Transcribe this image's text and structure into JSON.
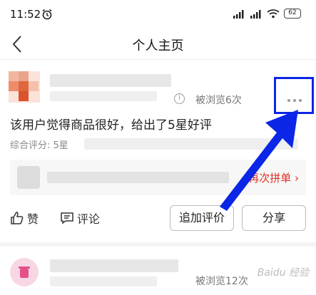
{
  "status_bar": {
    "time": "11:52",
    "battery": "62",
    "signal_1": "5G",
    "signal_2": "5G"
  },
  "nav": {
    "title": "个人主页"
  },
  "review": {
    "views": "被浏览6次",
    "text": "该用户觉得商品很好，给出了5星好评",
    "score_label": "综合评分: 5星",
    "rebuy_label": "再次拼单",
    "like_label": "赞",
    "comment_label": "评论",
    "add_review_label": "追加评价",
    "share_label": "分享"
  },
  "review_2": {
    "views": "被浏览12次"
  },
  "watermark": "Baidu 经验",
  "colors": {
    "accent_red": "#e02e24",
    "annotation_blue": "#0b26e6"
  }
}
